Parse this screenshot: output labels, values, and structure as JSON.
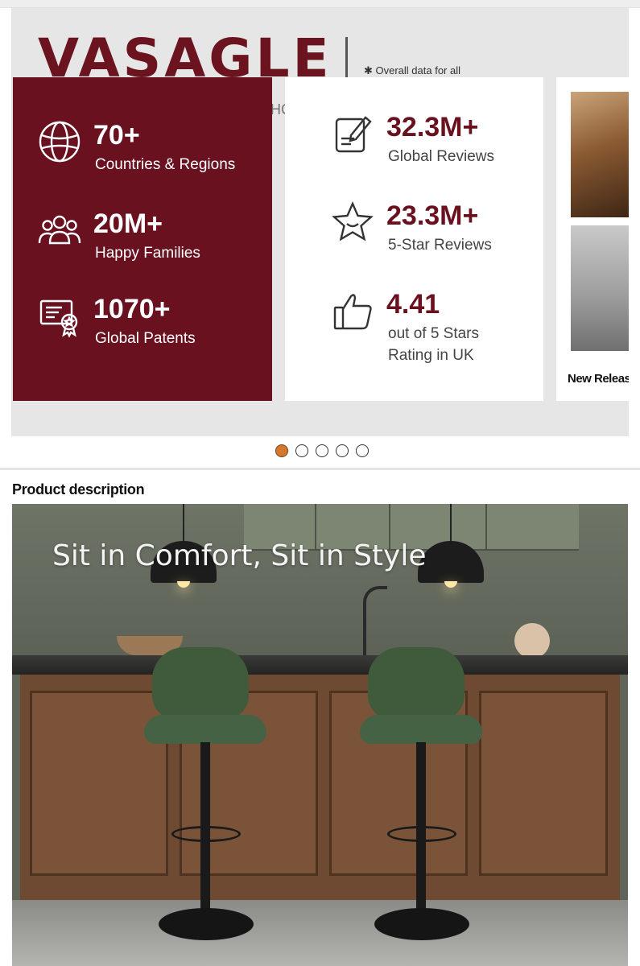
{
  "brand": {
    "name": "VASAGLE",
    "note": "✱ Overall data for all",
    "sub_partial": "HC"
  },
  "colors": {
    "brand_red": "#6a1120",
    "active_dot": "#d2782f"
  },
  "stats_left": [
    {
      "icon": "globe-icon",
      "value": "70+",
      "label": "Countries & Regions"
    },
    {
      "icon": "family-icon",
      "value": "20M+",
      "label": "Happy Families"
    },
    {
      "icon": "patent-certificate-icon",
      "value": "1070+",
      "label": "Global Patents"
    }
  ],
  "stats_right": [
    {
      "icon": "review-edit-icon",
      "value": "32.3M+",
      "label": "Global Reviews"
    },
    {
      "icon": "star-icon",
      "value": "23.3M+",
      "label": "5-Star Reviews"
    },
    {
      "icon": "thumbs-up-icon",
      "value": "4.41",
      "label_line1": "out of 5 Stars",
      "label_line2": "Rating in UK"
    }
  ],
  "next_card": {
    "label": "New Releas"
  },
  "carousel": {
    "dot_count": 5,
    "active_index": 0
  },
  "product_description": {
    "title": "Product description",
    "hero_caption": "Sit in Comfort, Sit in Style"
  }
}
